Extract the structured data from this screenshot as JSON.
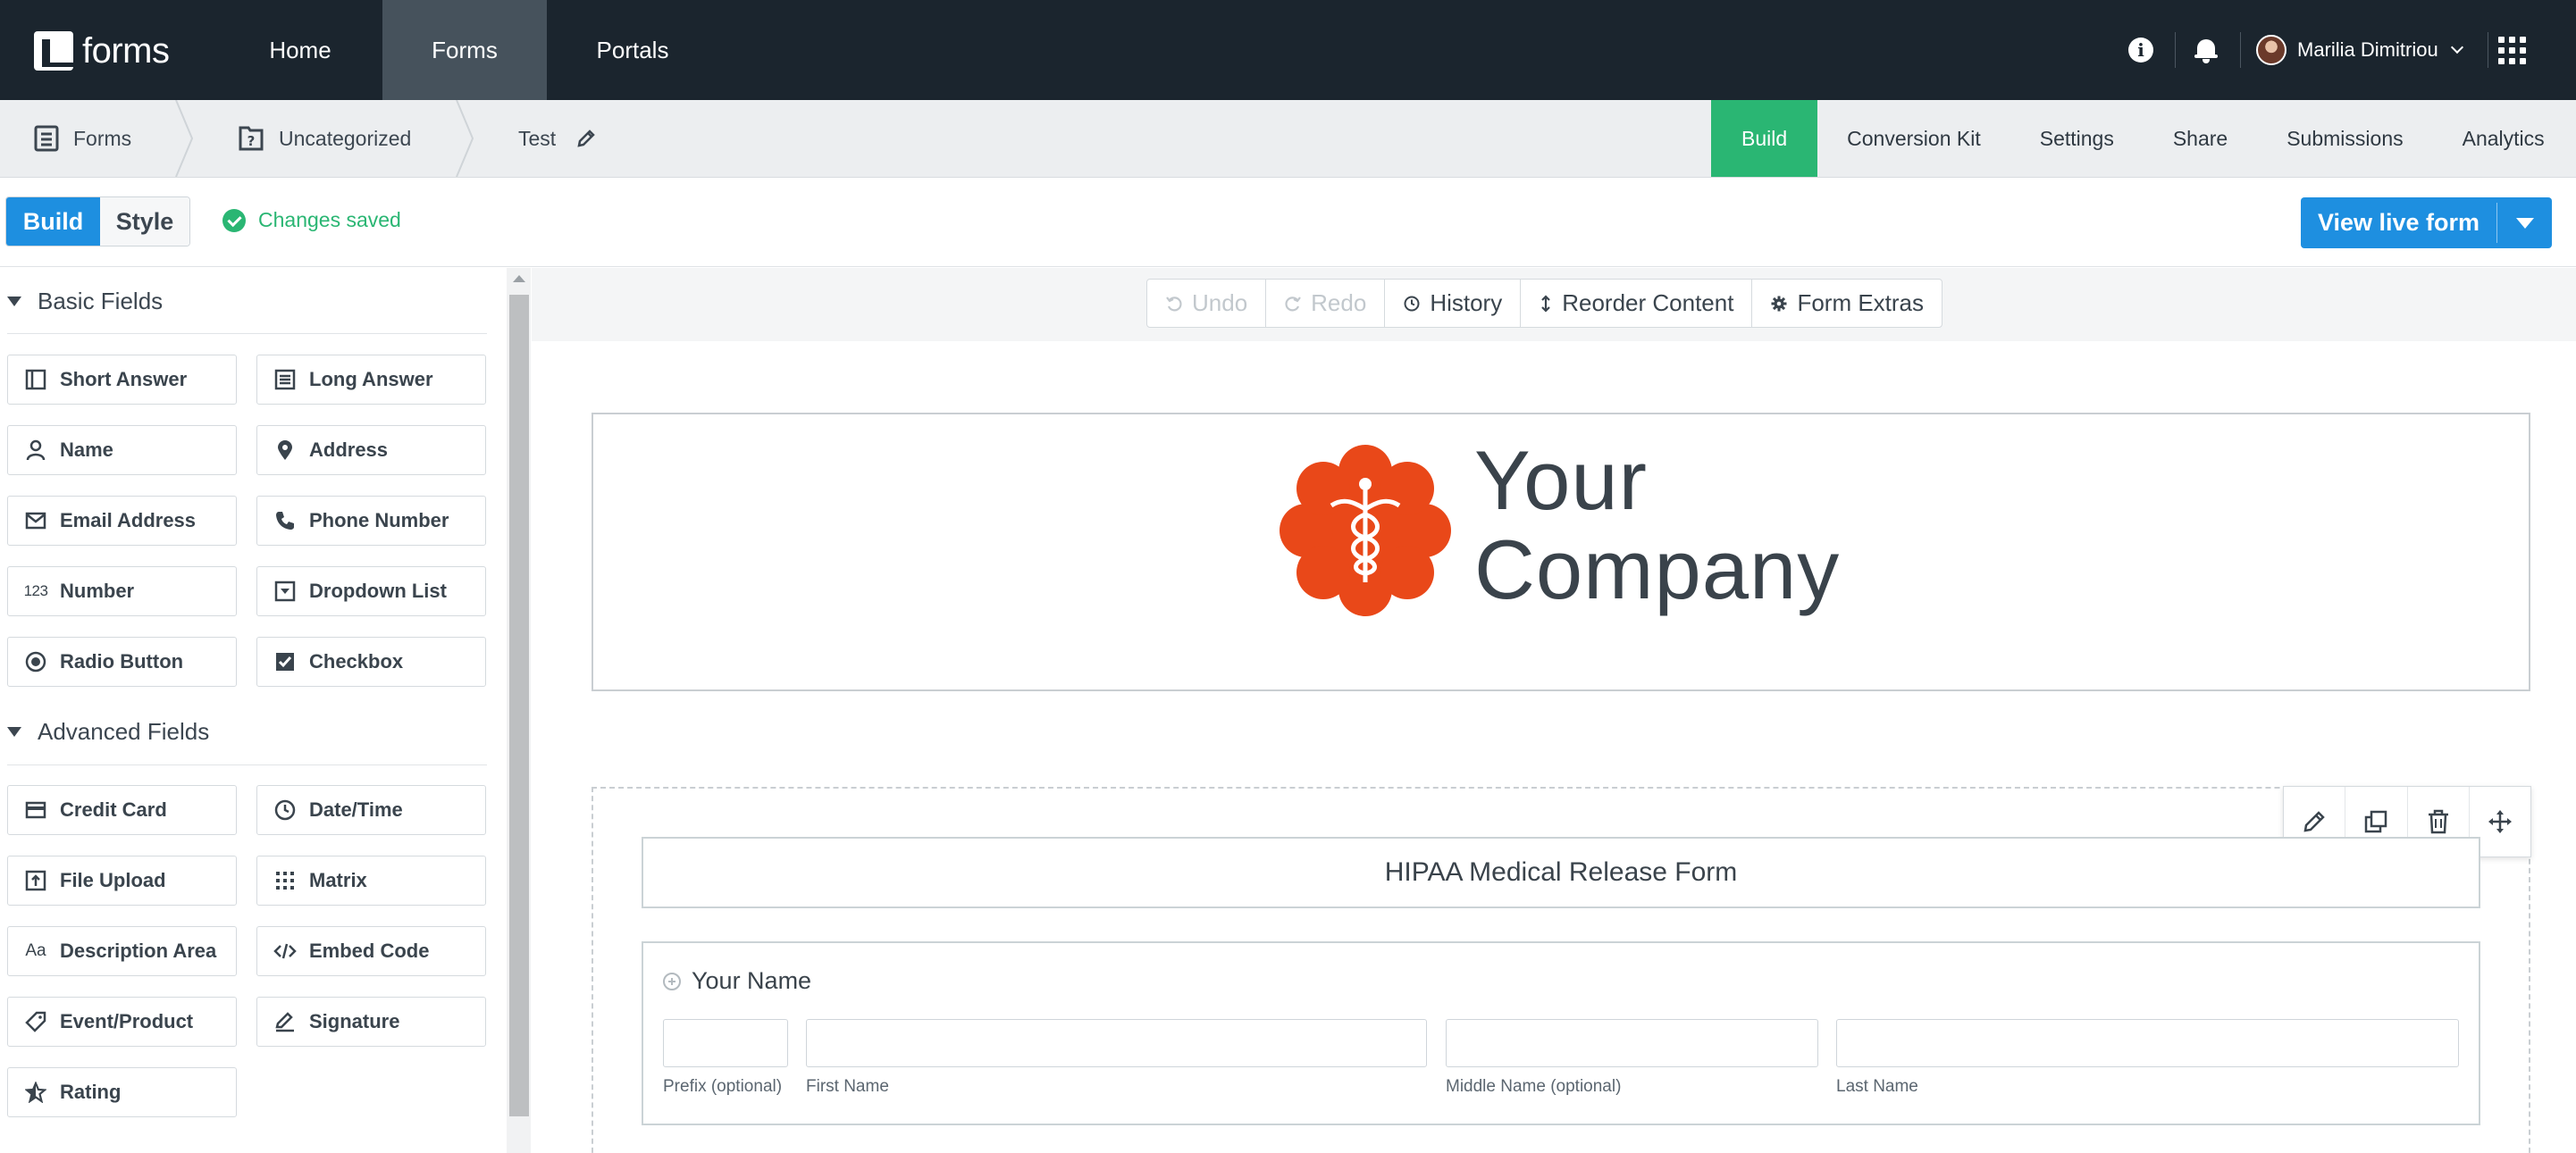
{
  "brand": {
    "logo_text": "forms"
  },
  "topnav": {
    "links": [
      {
        "label": "Home"
      },
      {
        "label": "Forms"
      },
      {
        "label": "Portals"
      }
    ],
    "user_name": "Marilia Dimitriou"
  },
  "breadcrumb": {
    "items": [
      {
        "label": "Forms"
      },
      {
        "label": "Uncategorized"
      },
      {
        "label": "Test"
      }
    ]
  },
  "form_tabs": [
    {
      "label": "Build",
      "active": true
    },
    {
      "label": "Conversion Kit"
    },
    {
      "label": "Settings"
    },
    {
      "label": "Share"
    },
    {
      "label": "Submissions"
    },
    {
      "label": "Analytics"
    }
  ],
  "mode_toggle": {
    "build": "Build",
    "style": "Style"
  },
  "status": {
    "saved_text": "Changes saved"
  },
  "view_live": {
    "label": "View live form"
  },
  "sidebar": {
    "basic_title": "Basic Fields",
    "basic_fields": [
      {
        "label": "Short Answer"
      },
      {
        "label": "Long Answer"
      },
      {
        "label": "Name"
      },
      {
        "label": "Address"
      },
      {
        "label": "Email Address"
      },
      {
        "label": "Phone Number"
      },
      {
        "label": "Number"
      },
      {
        "label": "Dropdown List"
      },
      {
        "label": "Radio Button"
      },
      {
        "label": "Checkbox"
      }
    ],
    "advanced_title": "Advanced Fields",
    "advanced_fields": [
      {
        "label": "Credit Card"
      },
      {
        "label": "Date/Time"
      },
      {
        "label": "File Upload"
      },
      {
        "label": "Matrix"
      },
      {
        "label": "Description Area"
      },
      {
        "label": "Embed Code"
      },
      {
        "label": "Event/Product"
      },
      {
        "label": "Signature"
      },
      {
        "label": "Rating"
      }
    ]
  },
  "toolbar": {
    "undo": "Undo",
    "redo": "Redo",
    "history": "History",
    "reorder": "Reorder Content",
    "extras": "Form Extras"
  },
  "header_logo": {
    "line1": "Your",
    "line2": "Company"
  },
  "form": {
    "title": "HIPAA Medical Release Form",
    "name_question": "Your Name",
    "name_sublabels": [
      "Prefix (optional)",
      "First Name",
      "Middle Name (optional)",
      "Last Name"
    ]
  },
  "colors": {
    "topnav_bg": "#1b252e",
    "active_tab": "#2ab673",
    "primary_button": "#1e8fe0",
    "logo_orange": "#e94819"
  }
}
